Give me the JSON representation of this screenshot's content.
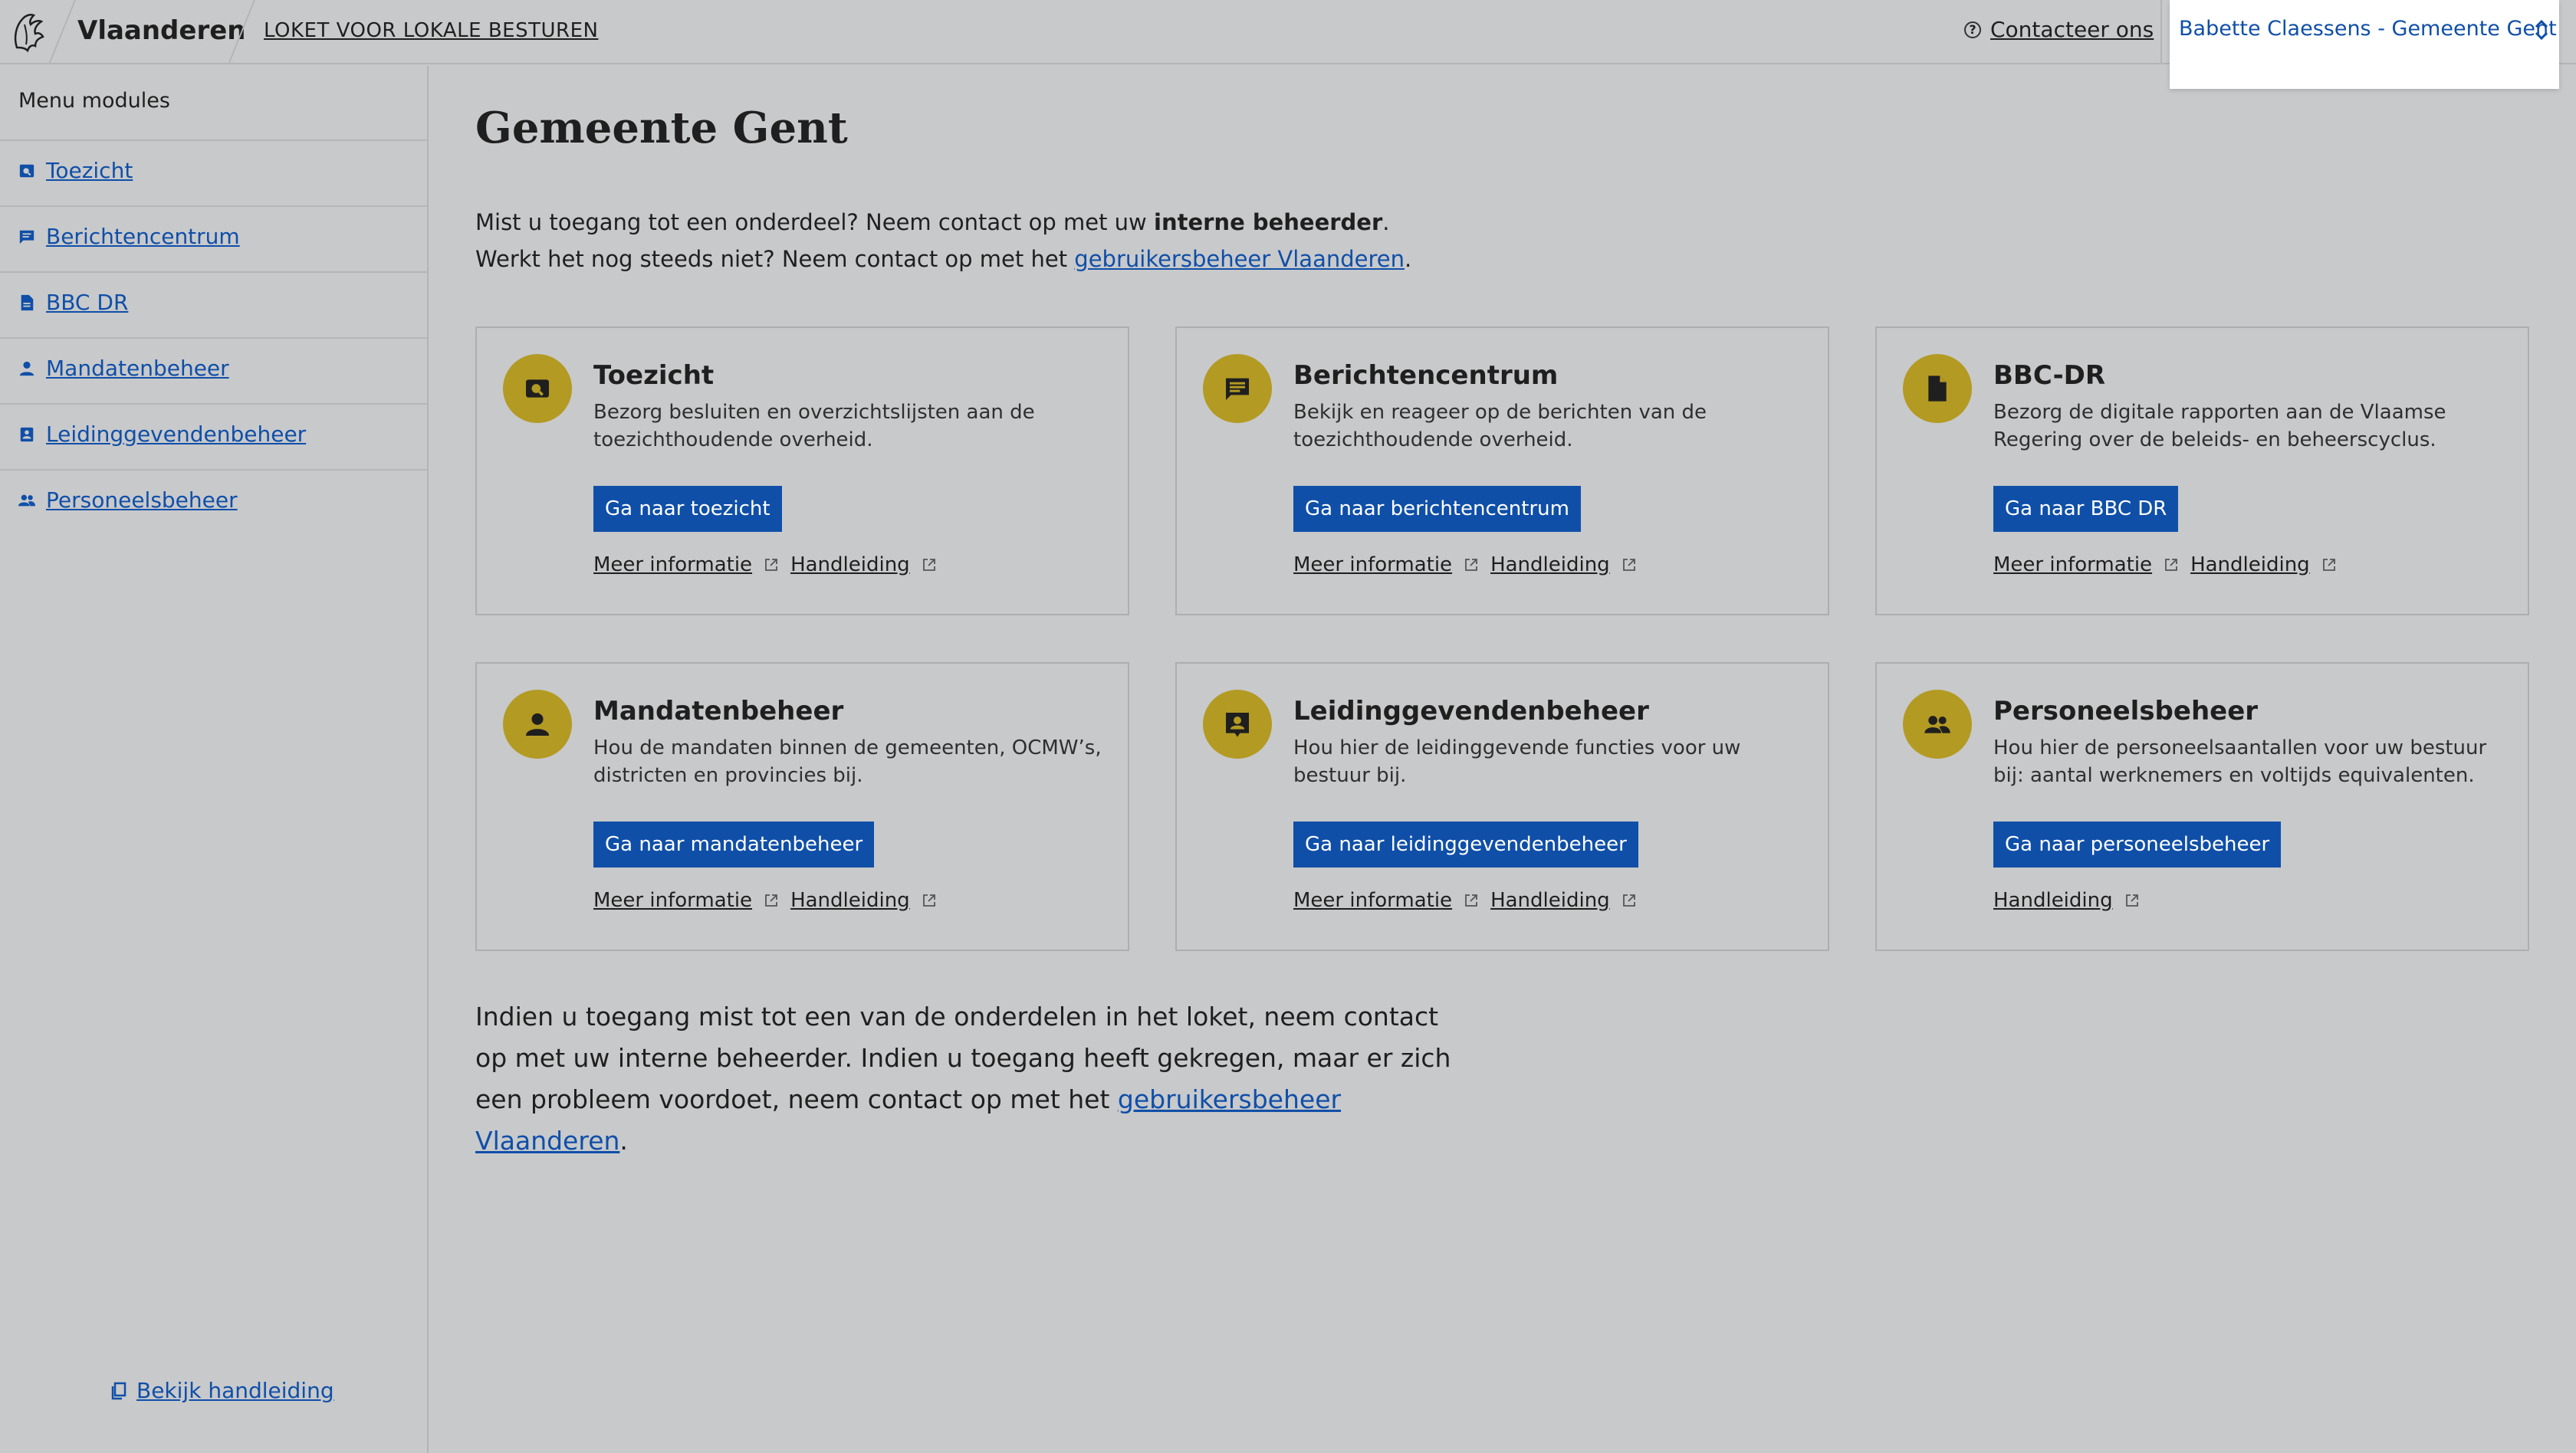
{
  "header": {
    "brand": "Vlaanderen",
    "app_title": "LOKET VOOR LOKALE BESTUREN",
    "contact_label": "Contacteer ons",
    "user_label": "Babette Claessens - Gemeente Gent"
  },
  "sidebar": {
    "heading": "Menu modules",
    "items": [
      {
        "label": "Toezicht",
        "icon": "search-doc-icon"
      },
      {
        "label": "Berichtencentrum",
        "icon": "message-icon"
      },
      {
        "label": "BBC DR",
        "icon": "document-icon"
      },
      {
        "label": "Mandatenbeheer",
        "icon": "person-icon"
      },
      {
        "label": "Leidinggevendenbeheer",
        "icon": "badge-icon"
      },
      {
        "label": "Personeelsbeheer",
        "icon": "people-icon"
      }
    ],
    "footer_link": "Bekijk handleiding"
  },
  "main": {
    "title": "Gemeente Gent",
    "intro": {
      "line1_pre": "Mist u toegang tot een onderdeel? Neem contact op met uw ",
      "line1_bold": "interne beheerder",
      "line1_post": ".",
      "line2_pre": "Werkt het nog steeds niet? Neem contact op met het ",
      "line2_link": "gebruikersbeheer Vlaanderen",
      "line2_post": "."
    },
    "cards": [
      {
        "title": "Toezicht",
        "desc": "Bezorg besluiten en overzichtslijsten aan de toezichthoudende overheid.",
        "button": "Ga naar toezicht",
        "more": "Meer informatie",
        "manual": "Handleiding",
        "icon": "search-doc-icon"
      },
      {
        "title": "Berichtencentrum",
        "desc": "Bekijk en reageer op de berichten van de toezichthoudende overheid.",
        "button": "Ga naar berichtencentrum",
        "more": "Meer informatie",
        "manual": "Handleiding",
        "icon": "message-icon"
      },
      {
        "title": "BBC-DR",
        "desc": "Bezorg de digitale rapporten aan de Vlaamse Regering over de beleids- en beheerscyclus.",
        "button": "Ga naar BBC DR",
        "more": "Meer informatie",
        "manual": "Handleiding",
        "icon": "document-icon"
      },
      {
        "title": "Mandatenbeheer",
        "desc": "Hou de mandaten binnen de gemeenten, OCMW’s, districten en provincies bij.",
        "button": "Ga naar mandatenbeheer",
        "more": "Meer informatie",
        "manual": "Handleiding",
        "icon": "person-icon"
      },
      {
        "title": "Leidinggevendenbeheer",
        "desc": "Hou hier de leidinggevende functies voor uw bestuur bij.",
        "button": "Ga naar leidinggevendenbeheer",
        "more": "Meer informatie",
        "manual": "Handleiding",
        "icon": "badge-icon"
      },
      {
        "title": "Personeelsbeheer",
        "desc": "Hou hier de personeelsaantallen voor uw bestuur bij: aantal werknemers en voltijds equivalenten.",
        "button": "Ga naar personeelsbeheer",
        "manual": "Handleiding",
        "icon": "people-icon"
      }
    ],
    "outro": {
      "pre": "Indien u toegang mist tot een van de onderdelen in het loket, neem contact op met uw interne beheerder. Indien u toegang heeft gekregen, maar er zich een probleem voordoet, neem contact op met het ",
      "link": "gebruikersbeheer Vlaanderen",
      "post": "."
    }
  },
  "colors": {
    "accent": "#0f4fa8",
    "icon_circle": "#b39a23",
    "background": "#c8c9cb"
  }
}
